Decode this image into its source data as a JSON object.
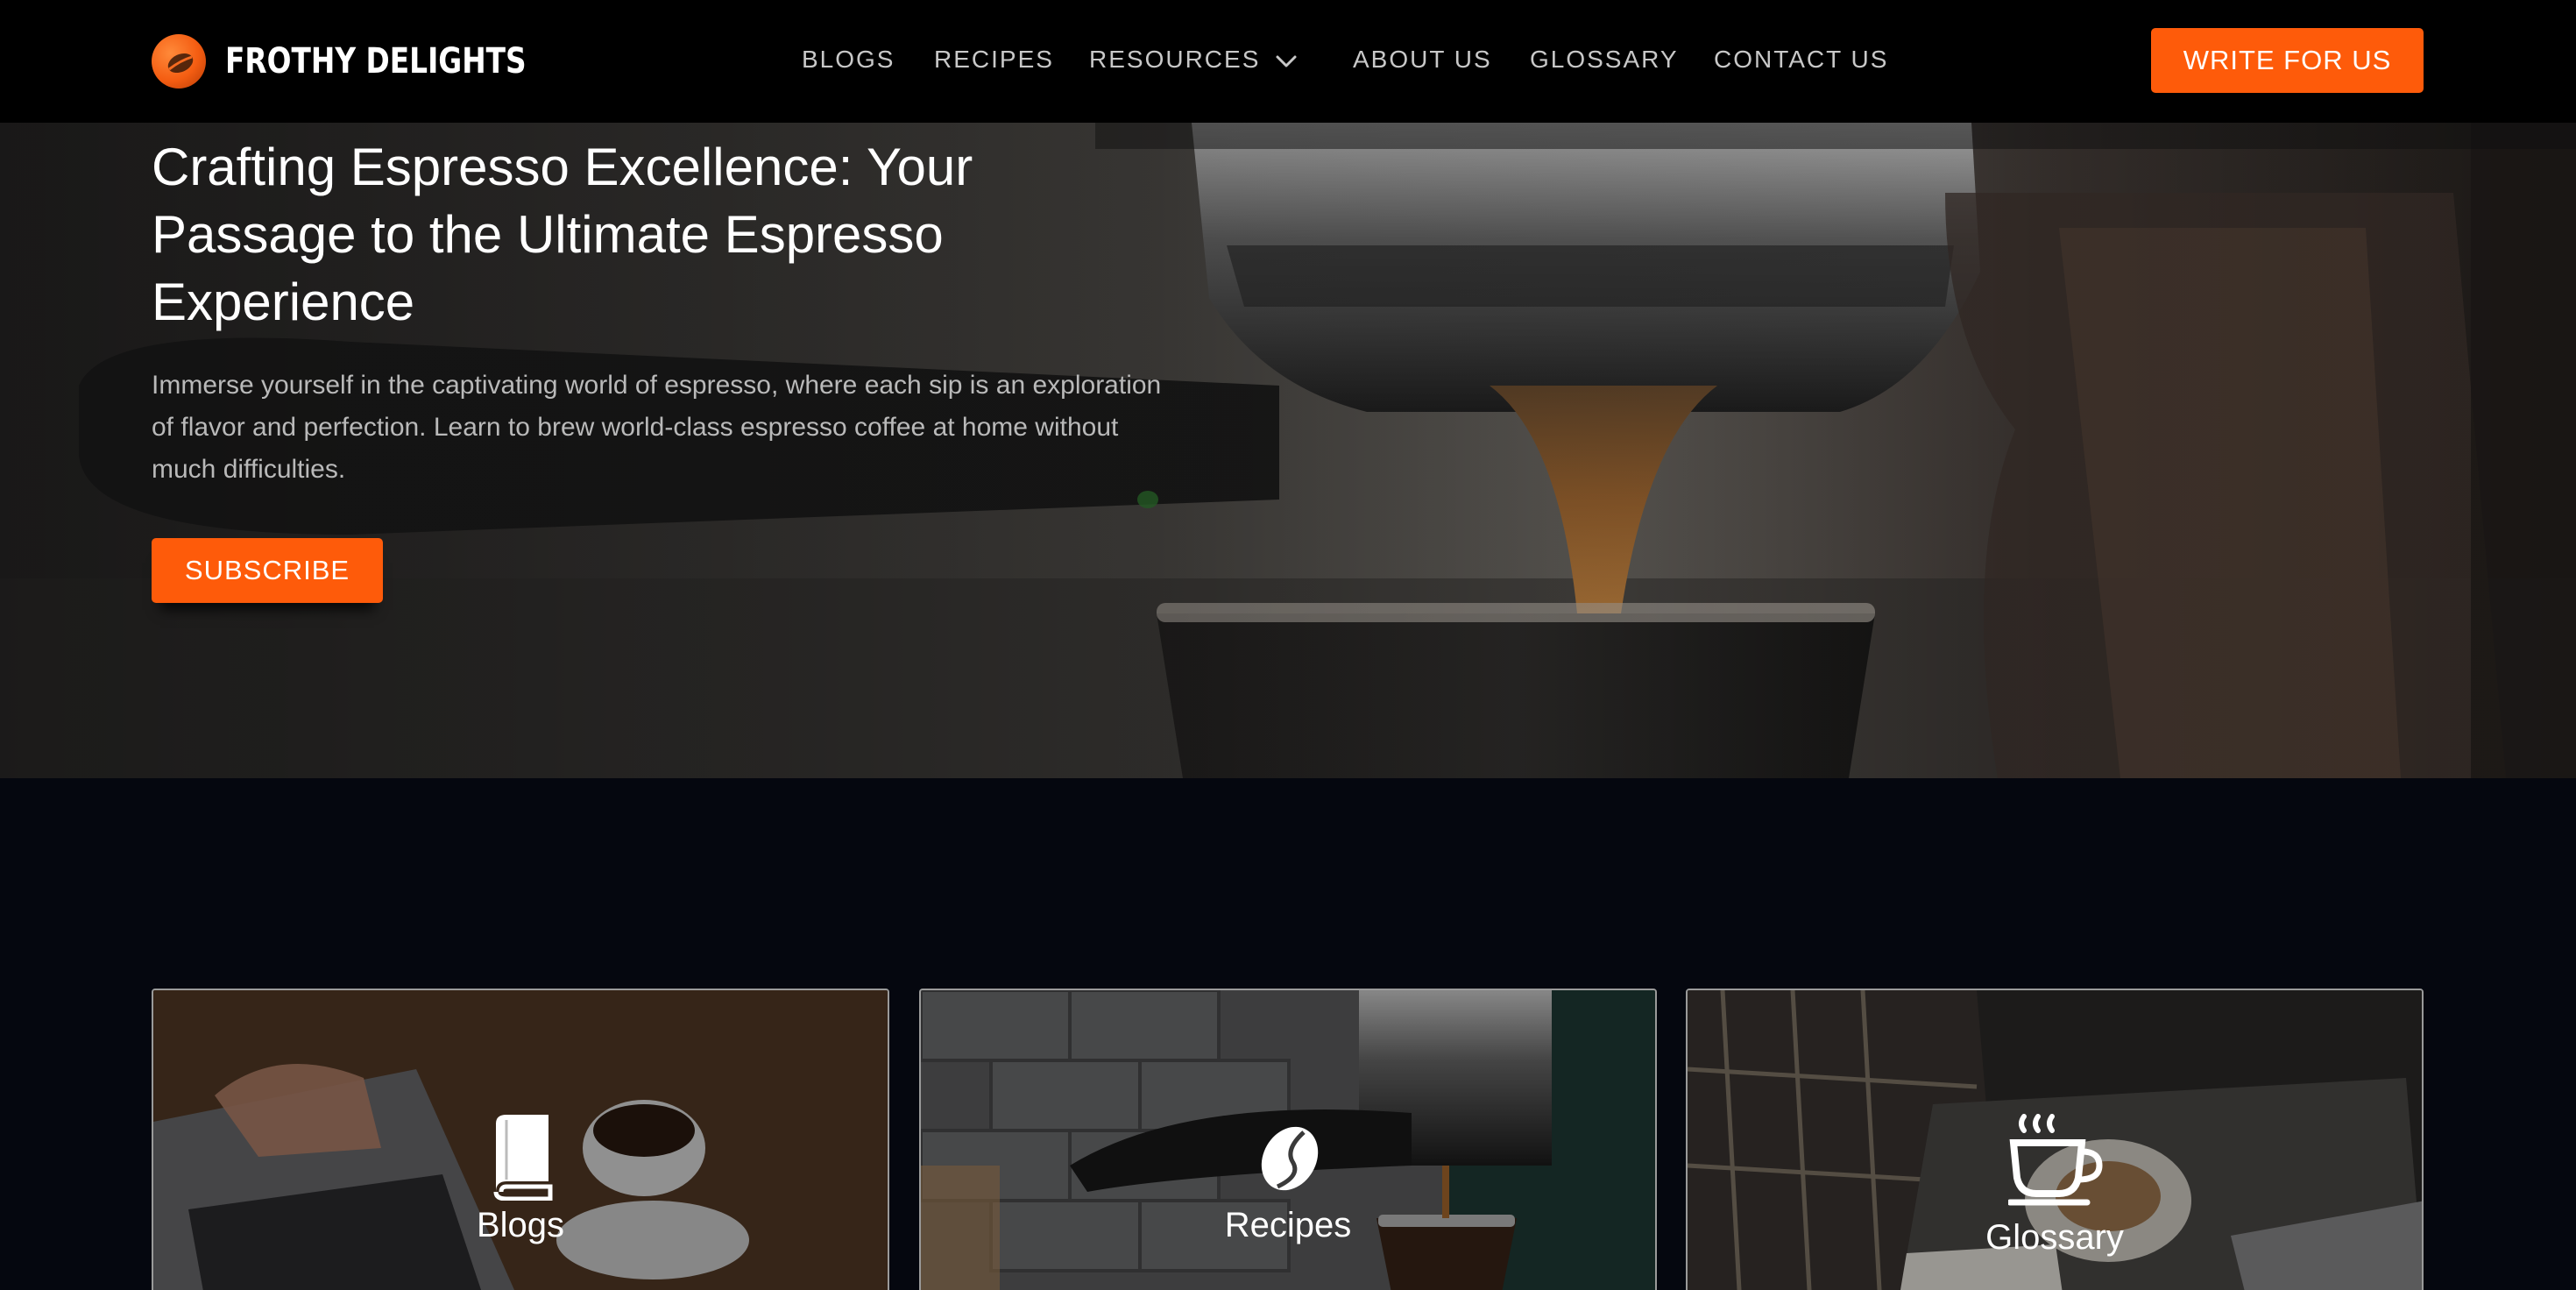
{
  "brand": {
    "name": "FROTHY DELIGHTS",
    "accent_color": "#fe5b0a",
    "logo_icon": "coffee-bean-icon"
  },
  "nav": {
    "items": [
      "BLOGS",
      "RECIPES",
      "RESOURCES",
      "ABOUT US",
      "GLOSSARY",
      "CONTACT US"
    ],
    "resources_dropdown_icon": "chevron-down-icon",
    "cta": "WRITE FOR US"
  },
  "hero": {
    "title": "Crafting Espresso Excellence: Your Passage to the Ultimate Espresso Experience",
    "text": "Immerse yourself in the captivating world of espresso, where each sip is an exploration of flavor and perfection. Learn to brew world-class espresso coffee at home without much difficulties.",
    "button": "SUBSCRIBE"
  },
  "cards": [
    {
      "label": "Blogs",
      "icon": "book-icon"
    },
    {
      "label": "Recipes",
      "icon": "coffee-bean-icon"
    },
    {
      "label": "Glossary",
      "icon": "coffee-cup-icon"
    }
  ]
}
